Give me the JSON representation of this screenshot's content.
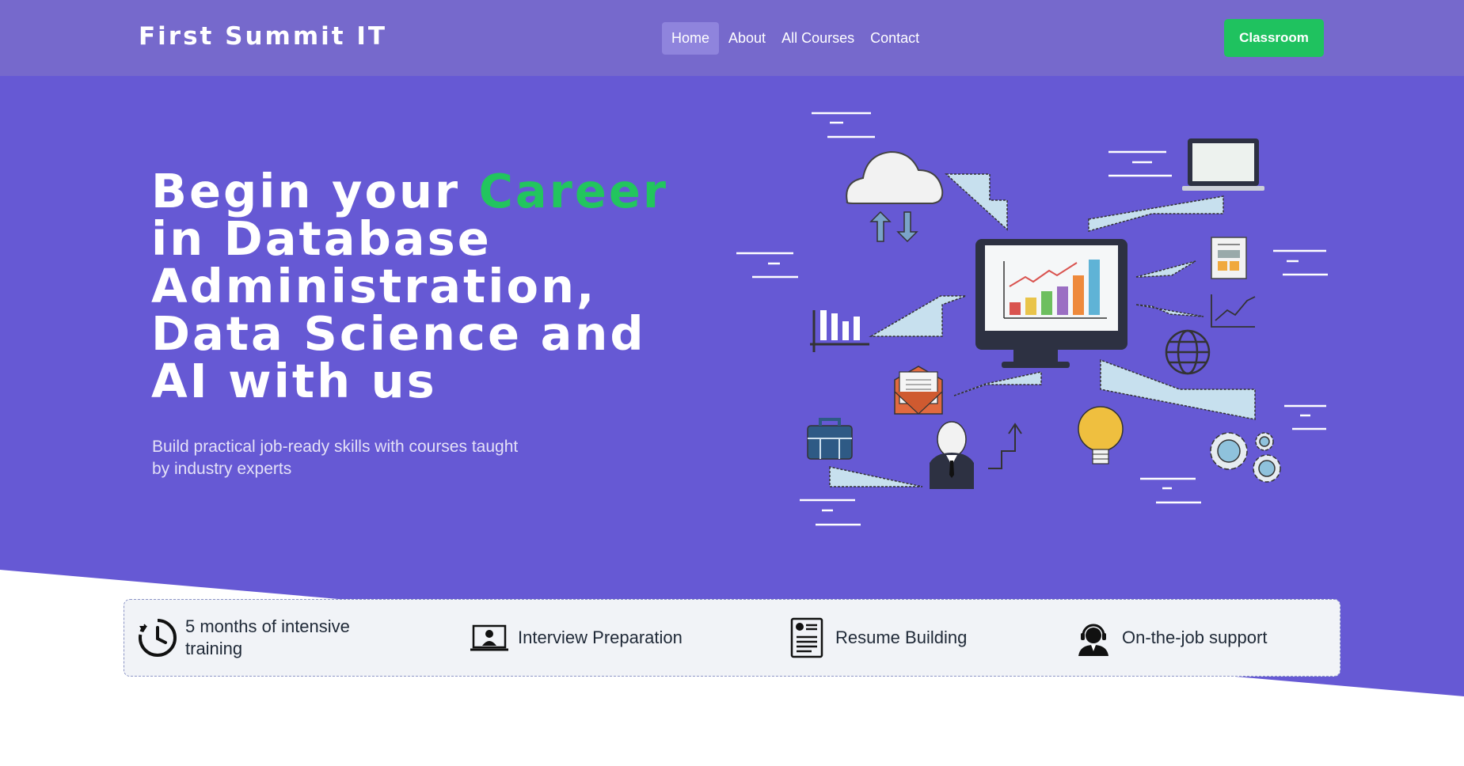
{
  "nav": {
    "brand": "First Summit IT",
    "links": [
      {
        "label": "Home",
        "active": true
      },
      {
        "label": "About",
        "active": false
      },
      {
        "label": "All Courses",
        "active": false
      },
      {
        "label": "Contact",
        "active": false
      }
    ],
    "cta_label": "Classroom"
  },
  "hero": {
    "title_part1": "Begin your ",
    "title_accent": "Career",
    "title_part2": "in Database Administration, Data Science and AI with us",
    "subtitle": "Build practical job-ready skills with courses taught by industry experts"
  },
  "features": [
    {
      "label": "5 months of intensive training",
      "icon": "clock-history-icon"
    },
    {
      "label": "Interview Preparation",
      "icon": "video-call-icon"
    },
    {
      "label": "Resume Building",
      "icon": "resume-icon"
    },
    {
      "label": "On-the-job support",
      "icon": "support-agent-icon"
    }
  ],
  "colors": {
    "hero_bg": "#6659d4",
    "nav_bg": "#7669cc",
    "accent_green": "#22c55e",
    "cta_green": "#1fc25f"
  }
}
